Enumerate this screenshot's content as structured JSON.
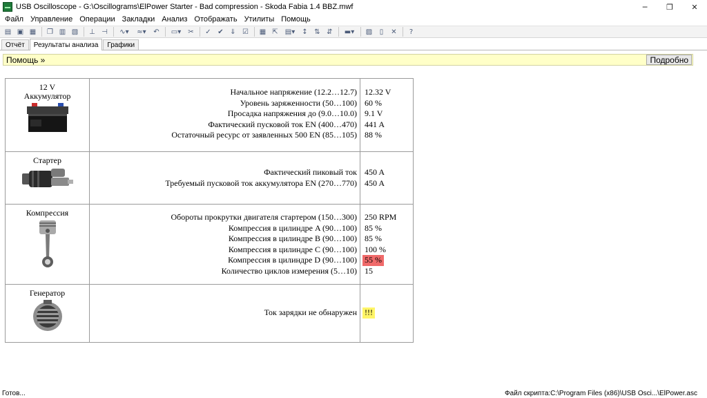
{
  "window": {
    "title": "USB Oscilloscope - G:\\Oscillograms\\ElPower Starter - Bad compression - Skoda Fabia 1.4 BBZ.mwf",
    "minimize_glyph": "─",
    "restore_glyph": "❐",
    "close_glyph": "✕"
  },
  "menu": [
    "Файл",
    "Управление",
    "Операции",
    "Закладки",
    "Анализ",
    "Отображать",
    "Утилиты",
    "Помощь"
  ],
  "tabs": [
    {
      "label": "Отчёт",
      "active": false
    },
    {
      "label": "Результаты анализа",
      "active": true
    },
    {
      "label": "Графики",
      "active": false
    }
  ],
  "help": {
    "link": "Помощь »",
    "detail_button": "Подробно"
  },
  "sections": [
    {
      "device_lines": [
        "12 V",
        "Аккумулятор"
      ],
      "icon": "car-battery-icon",
      "pad_top": 12,
      "rows": [
        {
          "label": "Начальное напряжение (12.2…12.7)",
          "value": "12.32 V",
          "status": "ok"
        },
        {
          "label": "Уровень заряженности (50…100)",
          "value": "60 %",
          "status": "ok"
        },
        {
          "label": "Просадка напряжения до (9.0…10.0)",
          "value": "9.1 V",
          "status": "ok"
        },
        {
          "label": "Фактический пусковой ток EN (400…470)",
          "value": "441 A",
          "status": "ok"
        },
        {
          "label": "Остаточный ресурс от заявленных 500 EN (85…105)",
          "value": "88 %",
          "status": "ok"
        }
      ]
    },
    {
      "device_lines": [
        "Стартер"
      ],
      "icon": "starter-motor-icon",
      "pad_top": 22,
      "rows": [
        {
          "label": "Фактический пиковый ток",
          "value": "450 A",
          "status": "ok"
        },
        {
          "label": "Требуемый пусковой ток аккумулятора EN (270…770)",
          "value": "450 A",
          "status": "ok"
        }
      ]
    },
    {
      "device_lines": [
        "Компрессия"
      ],
      "icon": "piston-icon",
      "pad_top": 11,
      "rows": [
        {
          "label": "Обороты прокрутки двигателя стартером (150…300)",
          "value": "250 RPM",
          "status": "ok"
        },
        {
          "label": "Компрессия в цилиндре A (90…100)",
          "value": "85 %",
          "status": "ok"
        },
        {
          "label": "Компрессия в цилиндре B (90…100)",
          "value": "85 %",
          "status": "ok"
        },
        {
          "label": "Компрессия в цилиндре C (90…100)",
          "value": "100 %",
          "status": "ok"
        },
        {
          "label": "Компрессия в цилиндре D (90…100)",
          "value": "55 %",
          "status": "bad"
        },
        {
          "label": "Количество циклов измерения (5…10)",
          "value": "15",
          "status": "ok"
        }
      ]
    },
    {
      "device_lines": [
        "Генератор"
      ],
      "icon": "alternator-icon",
      "pad_top": 33,
      "rows": [
        {
          "label": "Ток зарядки не обнаружен",
          "value": "!!!",
          "status": "warn"
        }
      ]
    }
  ],
  "status": {
    "left": "Готов...",
    "right": "Файл скрипта:C:\\Program Files (x86)\\USB Osci...\\ElPower.asc"
  },
  "colors": {
    "help_bar": "#ffffc8",
    "bad_value": "#f06a6a",
    "warn_value": "#fff568",
    "app_icon": "#1f7a3a"
  }
}
